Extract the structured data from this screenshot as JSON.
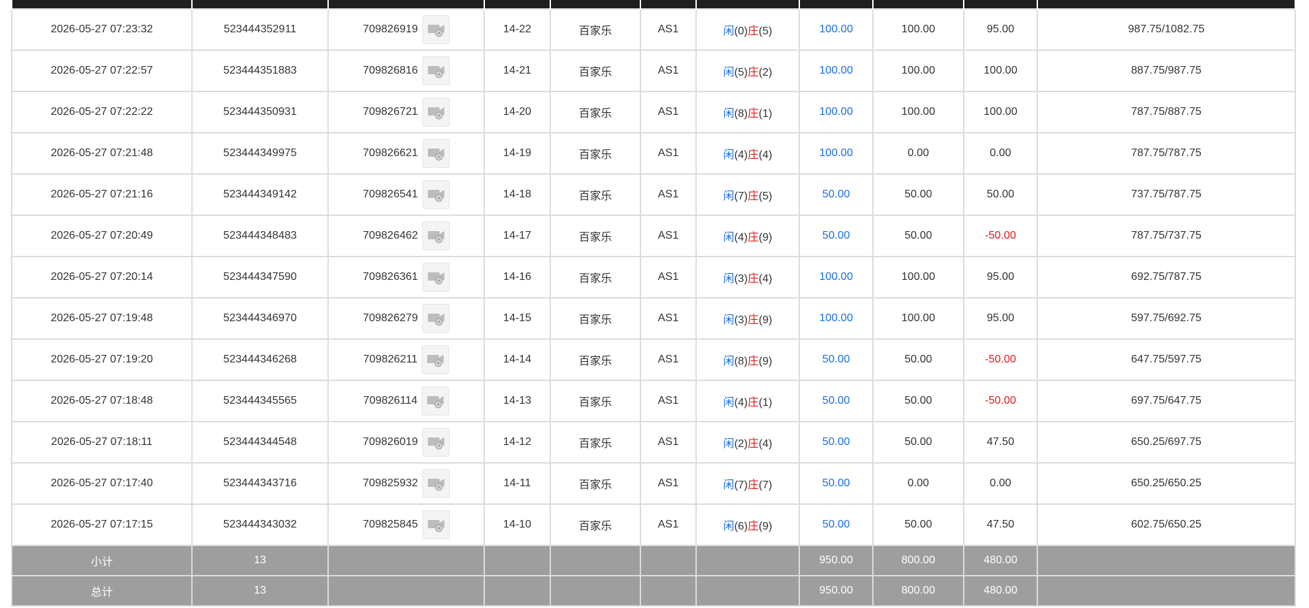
{
  "rows": [
    {
      "time": "2026-05-27 07:23:32",
      "order": "523444352911",
      "round": "709826919",
      "shoe": "14-22",
      "game": "百家乐",
      "table": "AS1",
      "player_lbl": "闲",
      "player_val": "(0)",
      "banker_lbl": "庄",
      "banker_val": "(5)",
      "bet": "100.00",
      "valid": "100.00",
      "win": "95.00",
      "win_neg": false,
      "balance": "987.75/1082.75"
    },
    {
      "time": "2026-05-27 07:22:57",
      "order": "523444351883",
      "round": "709826816",
      "shoe": "14-21",
      "game": "百家乐",
      "table": "AS1",
      "player_lbl": "闲",
      "player_val": "(5)",
      "banker_lbl": "庄",
      "banker_val": "(2)",
      "bet": "100.00",
      "valid": "100.00",
      "win": "100.00",
      "win_neg": false,
      "balance": "887.75/987.75"
    },
    {
      "time": "2026-05-27 07:22:22",
      "order": "523444350931",
      "round": "709826721",
      "shoe": "14-20",
      "game": "百家乐",
      "table": "AS1",
      "player_lbl": "闲",
      "player_val": "(8)",
      "banker_lbl": "庄",
      "banker_val": "(1)",
      "bet": "100.00",
      "valid": "100.00",
      "win": "100.00",
      "win_neg": false,
      "balance": "787.75/887.75"
    },
    {
      "time": "2026-05-27 07:21:48",
      "order": "523444349975",
      "round": "709826621",
      "shoe": "14-19",
      "game": "百家乐",
      "table": "AS1",
      "player_lbl": "闲",
      "player_val": "(4)",
      "banker_lbl": "庄",
      "banker_val": "(4)",
      "bet": "100.00",
      "valid": "0.00",
      "win": "0.00",
      "win_neg": false,
      "balance": "787.75/787.75"
    },
    {
      "time": "2026-05-27 07:21:16",
      "order": "523444349142",
      "round": "709826541",
      "shoe": "14-18",
      "game": "百家乐",
      "table": "AS1",
      "player_lbl": "闲",
      "player_val": "(7)",
      "banker_lbl": "庄",
      "banker_val": "(5)",
      "bet": "50.00",
      "valid": "50.00",
      "win": "50.00",
      "win_neg": false,
      "balance": "737.75/787.75"
    },
    {
      "time": "2026-05-27 07:20:49",
      "order": "523444348483",
      "round": "709826462",
      "shoe": "14-17",
      "game": "百家乐",
      "table": "AS1",
      "player_lbl": "闲",
      "player_val": "(4)",
      "banker_lbl": "庄",
      "banker_val": "(9)",
      "bet": "50.00",
      "valid": "50.00",
      "win": "-50.00",
      "win_neg": true,
      "balance": "787.75/737.75"
    },
    {
      "time": "2026-05-27 07:20:14",
      "order": "523444347590",
      "round": "709826361",
      "shoe": "14-16",
      "game": "百家乐",
      "table": "AS1",
      "player_lbl": "闲",
      "player_val": "(3)",
      "banker_lbl": "庄",
      "banker_val": "(4)",
      "bet": "100.00",
      "valid": "100.00",
      "win": "95.00",
      "win_neg": false,
      "balance": "692.75/787.75"
    },
    {
      "time": "2026-05-27 07:19:48",
      "order": "523444346970",
      "round": "709826279",
      "shoe": "14-15",
      "game": "百家乐",
      "table": "AS1",
      "player_lbl": "闲",
      "player_val": "(3)",
      "banker_lbl": "庄",
      "banker_val": "(9)",
      "bet": "100.00",
      "valid": "100.00",
      "win": "95.00",
      "win_neg": false,
      "balance": "597.75/692.75"
    },
    {
      "time": "2026-05-27 07:19:20",
      "order": "523444346268",
      "round": "709826211",
      "shoe": "14-14",
      "game": "百家乐",
      "table": "AS1",
      "player_lbl": "闲",
      "player_val": "(8)",
      "banker_lbl": "庄",
      "banker_val": "(9)",
      "bet": "50.00",
      "valid": "50.00",
      "win": "-50.00",
      "win_neg": true,
      "balance": "647.75/597.75"
    },
    {
      "time": "2026-05-27 07:18:48",
      "order": "523444345565",
      "round": "709826114",
      "shoe": "14-13",
      "game": "百家乐",
      "table": "AS1",
      "player_lbl": "闲",
      "player_val": "(4)",
      "banker_lbl": "庄",
      "banker_val": "(1)",
      "bet": "50.00",
      "valid": "50.00",
      "win": "-50.00",
      "win_neg": true,
      "balance": "697.75/647.75"
    },
    {
      "time": "2026-05-27 07:18:11",
      "order": "523444344548",
      "round": "709826019",
      "shoe": "14-12",
      "game": "百家乐",
      "table": "AS1",
      "player_lbl": "闲",
      "player_val": "(2)",
      "banker_lbl": "庄",
      "banker_val": "(4)",
      "bet": "50.00",
      "valid": "50.00",
      "win": "47.50",
      "win_neg": false,
      "balance": "650.25/697.75"
    },
    {
      "time": "2026-05-27 07:17:40",
      "order": "523444343716",
      "round": "709825932",
      "shoe": "14-11",
      "game": "百家乐",
      "table": "AS1",
      "player_lbl": "闲",
      "player_val": "(7)",
      "banker_lbl": "庄",
      "banker_val": "(7)",
      "bet": "50.00",
      "valid": "0.00",
      "win": "0.00",
      "win_neg": false,
      "balance": "650.25/650.25"
    },
    {
      "time": "2026-05-27 07:17:15",
      "order": "523444343032",
      "round": "709825845",
      "shoe": "14-10",
      "game": "百家乐",
      "table": "AS1",
      "player_lbl": "闲",
      "player_val": "(6)",
      "banker_lbl": "庄",
      "banker_val": "(9)",
      "bet": "50.00",
      "valid": "50.00",
      "win": "47.50",
      "win_neg": false,
      "balance": "602.75/650.25"
    }
  ],
  "subtotal": {
    "label": "小计",
    "count": "13",
    "bet": "950.00",
    "valid": "800.00",
    "win": "480.00"
  },
  "total": {
    "label": "总计",
    "count": "13",
    "bet": "950.00",
    "valid": "800.00",
    "win": "480.00"
  },
  "colors": {
    "header": "#1f1f1f",
    "footer": "#9e9e9e",
    "player": "#1a6ee0",
    "banker": "#e01a1a",
    "bet": "#1a6ee0",
    "negative": "#e01a1a"
  },
  "icons": {
    "replay": "video-camera-icon"
  }
}
